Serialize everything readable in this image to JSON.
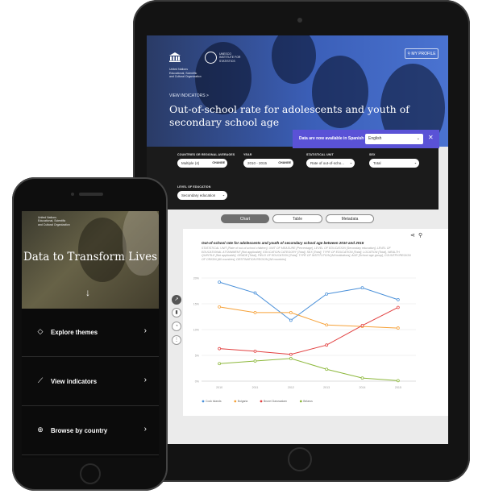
{
  "tablet": {
    "logo_unesco_text": "United Nations Educational, Scientific and Cultural Organization",
    "logo_uis_text": "UNESCO INSTITUTE FOR STATISTICS",
    "my_profile_btn": "MY PROFILE",
    "breadcrumb": "VIEW INDICATORS >",
    "title": "Out-of-school rate for adolescents and youth of secondary school age",
    "language_banner": {
      "text": "Data are now available in Spanish",
      "selected": "English",
      "close": "✕"
    },
    "filters": [
      {
        "label": "COUNTRIES OR REGIONAL AVERAGES",
        "value": "Multiple (4)",
        "action": "CHANGE"
      },
      {
        "label": "YEAR",
        "value": "2010 - 2015",
        "action": "CHANGE"
      },
      {
        "label": "STATISTICAL UNIT",
        "value": "Rate of out-of-scho...",
        "action": ""
      },
      {
        "label": "SEX",
        "value": "Total",
        "action": ""
      },
      {
        "label": "LEVEL OF EDUCATION",
        "value": "Secondary education",
        "action": ""
      }
    ],
    "tabs": [
      {
        "label": "Chart",
        "active": true
      },
      {
        "label": "Table",
        "active": false
      },
      {
        "label": "Metadata",
        "active": false
      }
    ],
    "chart_title": "Out-of-school rate for adolescents and youth of secondary school age between 2010 and 2015",
    "chart_subtitle": "STATISTICAL UNIT [Rate of out-of-school children], UNIT OF MEASURE [Percentage], LEVEL OF EDUCATION [Secondary education], LEVEL OF EDUCATIONAL ATTAINMENT [Not applicable], EDUCATION CATEGORY [Total], SEX [Total], TYPE OF EDUCATION [Total], LOCATION [Total], WEALTH QUINTILE [Not applicable], GRADE [Total], FIELD OF EDUCATION [Total], TYPE OF INSTITUTION [All institutions], AGE [School age group], COUNTRY/REGION OF ORIGIN [All countries], DESTINATION REGION [All countries]"
  },
  "chart_data": {
    "type": "line",
    "x": [
      "2010",
      "2011",
      "2012",
      "2013",
      "2014",
      "2015"
    ],
    "ylim": [
      0,
      20
    ],
    "yticks": [
      "0%",
      "5%",
      "10%",
      "15%",
      "20%"
    ],
    "grid": true,
    "legend": "bottom-left",
    "series": [
      {
        "name": "Cook Islands",
        "color": "#4a90d9",
        "values": [
          19.2,
          17.1,
          11.8,
          16.9,
          18.1,
          15.8
        ]
      },
      {
        "name": "Bulgaria",
        "color": "#f6a23a",
        "values": [
          14.4,
          13.3,
          13.3,
          10.9,
          10.6,
          10.3
        ]
      },
      {
        "name": "Brunei Darussalam",
        "color": "#e24040",
        "values": [
          6.3,
          5.8,
          5.2,
          7.0,
          10.8,
          14.3
        ]
      },
      {
        "name": "Belarus",
        "color": "#8db83c",
        "values": [
          3.4,
          3.9,
          4.4,
          2.3,
          0.6,
          0.1
        ]
      }
    ]
  },
  "phone": {
    "logo_text": "United Nations Educational, Scientific and Cultural Organization",
    "hero_title": "Data to Transform Lives",
    "arrow": "↓",
    "menu": [
      {
        "label": "Explore themes",
        "icon": "tag-icon"
      },
      {
        "label": "View indicators",
        "icon": "chart-line-icon"
      },
      {
        "label": "Browse by country",
        "icon": "globe-icon"
      }
    ],
    "chevron": "›"
  }
}
